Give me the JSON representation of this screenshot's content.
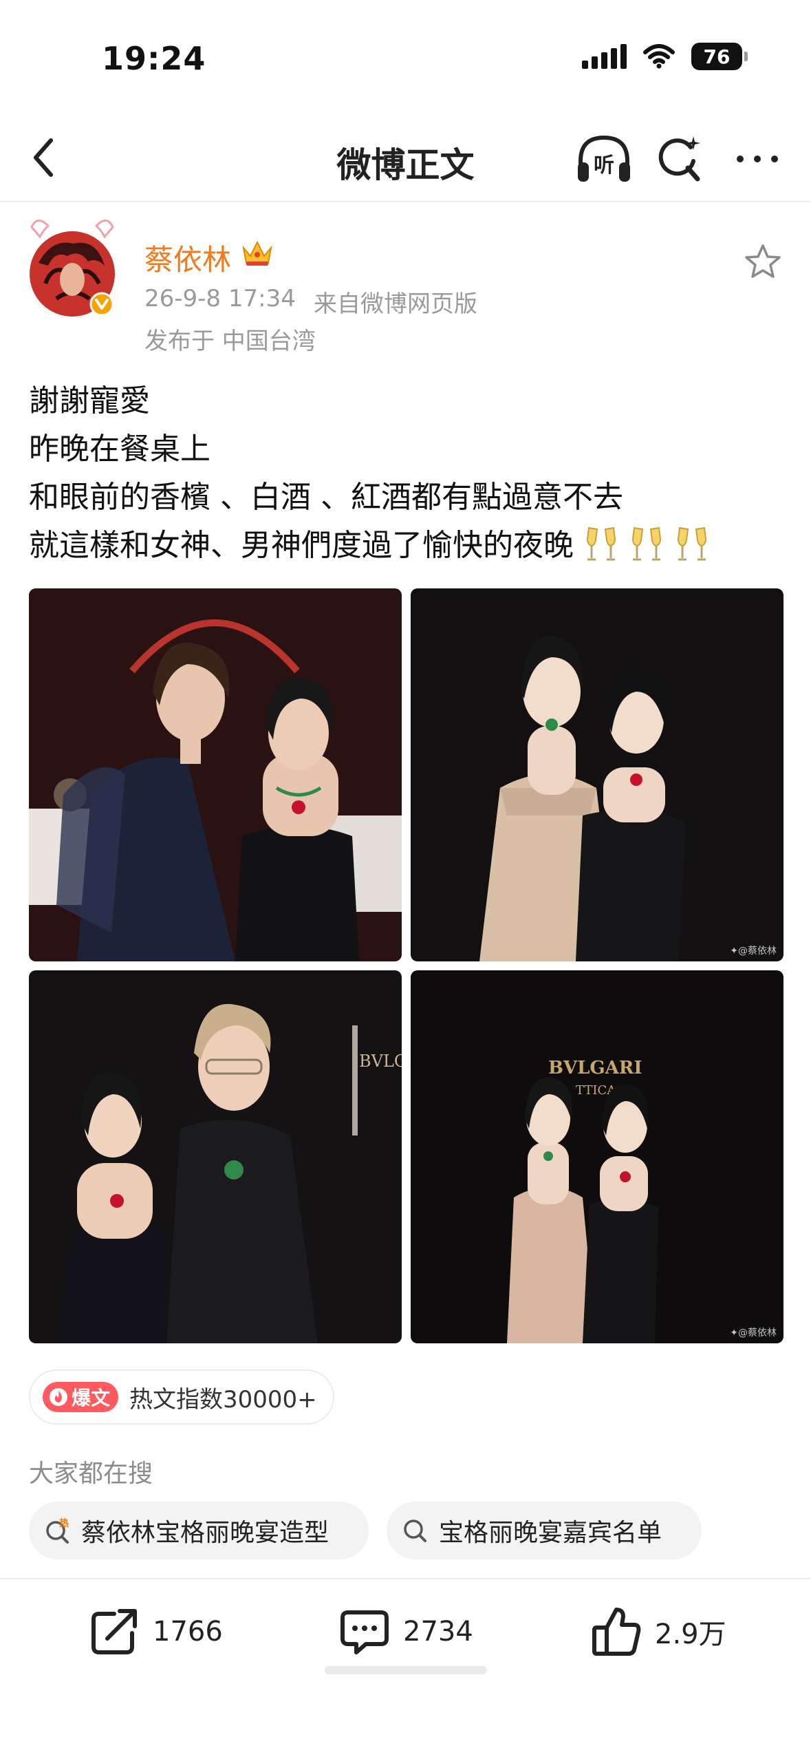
{
  "status_bar": {
    "time": "19:24",
    "battery": "76"
  },
  "nav": {
    "title": "微博正文",
    "listen_label": "听"
  },
  "post": {
    "author": "蔡依林",
    "time": "26-9-8 17:34",
    "source": "来自微博网页版",
    "location": "发布于 中国台湾",
    "body_lines": [
      "謝謝寵愛",
      "昨晚在餐桌上",
      "和眼前的香檳 、白酒 、紅酒都有點過意不去",
      "就這樣和女神、男神們度過了愉快的夜晚"
    ],
    "emoji": [
      "champagne-icon",
      "champagne-icon",
      "champagne-icon"
    ],
    "images": [
      {
        "watermark": ""
      },
      {
        "watermark": "✦@蔡依林"
      },
      {
        "watermark": ""
      },
      {
        "watermark": "✦@蔡依林"
      }
    ]
  },
  "hot": {
    "badge": "爆文",
    "index_text": "热文指数30000+"
  },
  "trending": {
    "heading": "大家都在搜",
    "hot_mark": "热",
    "items": [
      "蔡依林宝格丽晚宴造型",
      "宝格丽晚宴嘉宾名单"
    ]
  },
  "actions": {
    "shares": "1766",
    "comments": "2734",
    "likes": "2.9万"
  },
  "colors": {
    "author": "#f07a1c",
    "hot_badge": "#ff5a5f",
    "meta": "#9a9a9a"
  }
}
